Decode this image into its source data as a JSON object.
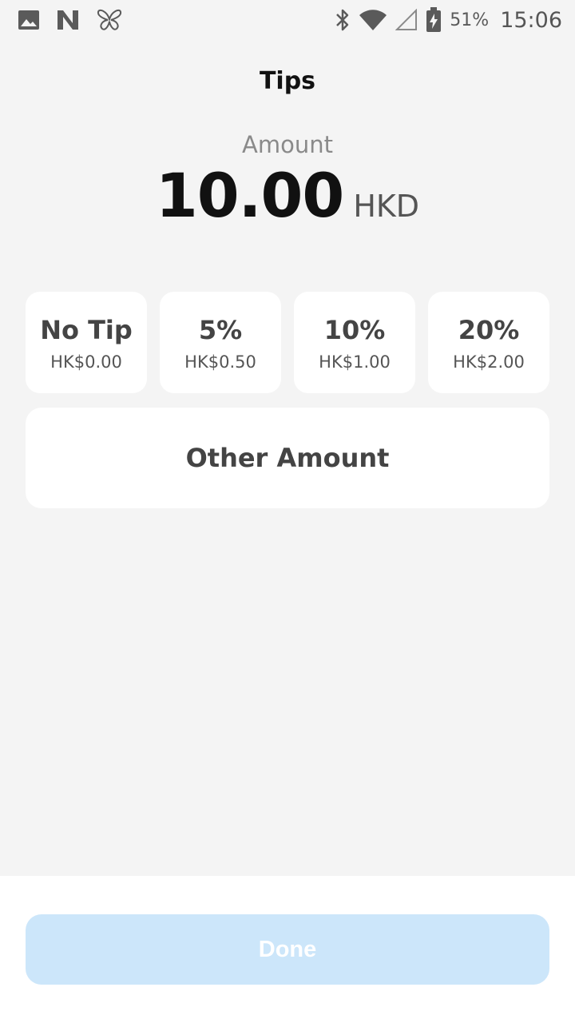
{
  "status_bar": {
    "battery_percent": "51%",
    "time": "15:06",
    "icons_left": [
      "image-icon",
      "n-app-icon",
      "butterfly-icon"
    ],
    "icons_right": [
      "bluetooth-icon",
      "wifi-icon",
      "cell-signal-icon",
      "battery-charging-icon"
    ]
  },
  "header": {
    "title": "Tips"
  },
  "amount": {
    "label": "Amount",
    "value": "10.00",
    "currency": "HKD"
  },
  "tip_options": [
    {
      "label": "No Tip",
      "amount": "HK$0.00"
    },
    {
      "label": "5%",
      "amount": "HK$0.50"
    },
    {
      "label": "10%",
      "amount": "HK$1.00"
    },
    {
      "label": "20%",
      "amount": "HK$2.00"
    }
  ],
  "other_amount": {
    "label": "Other Amount"
  },
  "footer": {
    "done_label": "Done",
    "done_color": "#cce6fa"
  }
}
